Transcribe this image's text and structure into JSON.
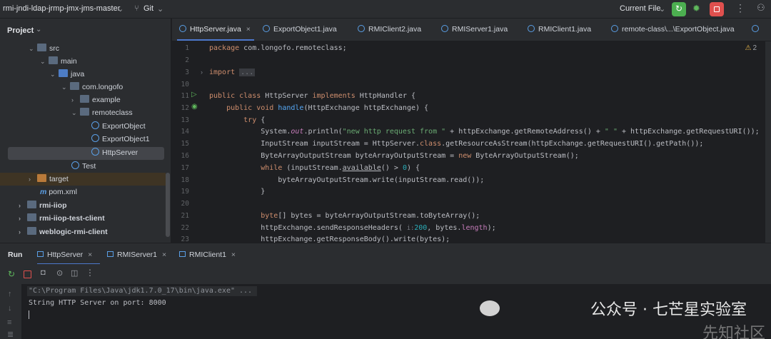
{
  "topbar": {
    "project_name": "rmi-jndi-ldap-jrmp-jmx-jms-master",
    "vcs": "Git",
    "run_config": "Current File"
  },
  "project_panel": {
    "title": "Project",
    "items": [
      {
        "label": "src",
        "kind": "folder"
      },
      {
        "label": "main",
        "kind": "folder"
      },
      {
        "label": "java",
        "kind": "folder-blue"
      },
      {
        "label": "com.longofo",
        "kind": "package"
      },
      {
        "label": "example",
        "kind": "package"
      },
      {
        "label": "remoteclass",
        "kind": "package"
      },
      {
        "label": "ExportObject",
        "kind": "class"
      },
      {
        "label": "ExportObject1",
        "kind": "class"
      },
      {
        "label": "HttpServer",
        "kind": "class"
      },
      {
        "label": "Test",
        "kind": "class"
      },
      {
        "label": "target",
        "kind": "folder-orange"
      },
      {
        "label": "pom.xml",
        "kind": "maven"
      },
      {
        "label": "rmi-iiop",
        "kind": "module"
      },
      {
        "label": "rmi-iiop-test-client",
        "kind": "module"
      },
      {
        "label": "weblogic-rmi-client",
        "kind": "module"
      }
    ]
  },
  "editor_tabs": [
    {
      "label": "HttpServer.java",
      "active": true
    },
    {
      "label": "ExportObject1.java"
    },
    {
      "label": "RMIClient2.java"
    },
    {
      "label": "RMIServer1.java"
    },
    {
      "label": "RMIClient1.java"
    },
    {
      "label": "remote-class\\...\\ExportObject.java"
    }
  ],
  "editor": {
    "warnings": "2",
    "line_numbers": [
      "1",
      "2",
      "3",
      "10",
      "11",
      "12",
      "13",
      "14",
      "15",
      "16",
      "17",
      "18",
      "19",
      "20",
      "21",
      "22",
      "23"
    ],
    "lines": {
      "l1a": "package ",
      "l1b": "com.longofo.remoteclass;",
      "l3a": "import ",
      "l3b": "...",
      "l11a": "public class ",
      "l11b": "HttpServer ",
      "l11c": "implements ",
      "l11d": "HttpHandler {",
      "l12a": "    public void ",
      "l12b": "handle",
      "l12c": "(HttpExchange httpExchange) {",
      "l13a": "        try ",
      "l13b": "{",
      "l14a": "            System.",
      "l14b": "out",
      "l14c": ".println(",
      "l14d": "\"new http request from \"",
      "l14e": " + httpExchange.getRemoteAddress() + ",
      "l14f": "\" \"",
      "l14g": " + httpExchange.getRequestURI());",
      "l15a": "            InputStream inputStream = HttpServer.",
      "l15b": "class",
      "l15c": ".getResourceAsStream(httpExchange.getRequestURI().getPath());",
      "l16a": "            ByteArrayOutputStream byteArrayOutputStream = ",
      "l16b": "new ",
      "l16c": "ByteArrayOutputStream();",
      "l17a": "            while ",
      "l17b": "(inputStream.",
      "l17c": "available",
      "l17d": "() > ",
      "l17e": "0",
      "l17f": ") {",
      "l18": "                byteArrayOutputStream.write(inputStream.read());",
      "l19": "            }",
      "l21a": "            byte",
      "l21b": "[] bytes = byteArrayOutputStream.toByteArray();",
      "l22a": "            httpExchange.sendResponseHeaders( ",
      "l22b": "i:",
      "l22c": "200",
      "l22d": ", bytes.",
      "l22e": "length",
      "l22f": ");",
      "l23": "            httpExchange.getResponseBody().write(bytes);"
    }
  },
  "run_panel": {
    "title": "Run",
    "tabs": [
      "HttpServer",
      "RMIServer1",
      "RMIClient1"
    ],
    "console_lines": [
      "\"C:\\Program Files\\Java\\jdk1.7.0_17\\bin\\java.exe\" ...",
      "String HTTP Server on port: 8000"
    ]
  },
  "watermark": {
    "text": "公众号 · 七芒星实验室",
    "text2": "先知社区"
  },
  "colors": {
    "accent": "#4d78cc",
    "run_green": "#4caf50",
    "stop_red": "#e0504e"
  }
}
